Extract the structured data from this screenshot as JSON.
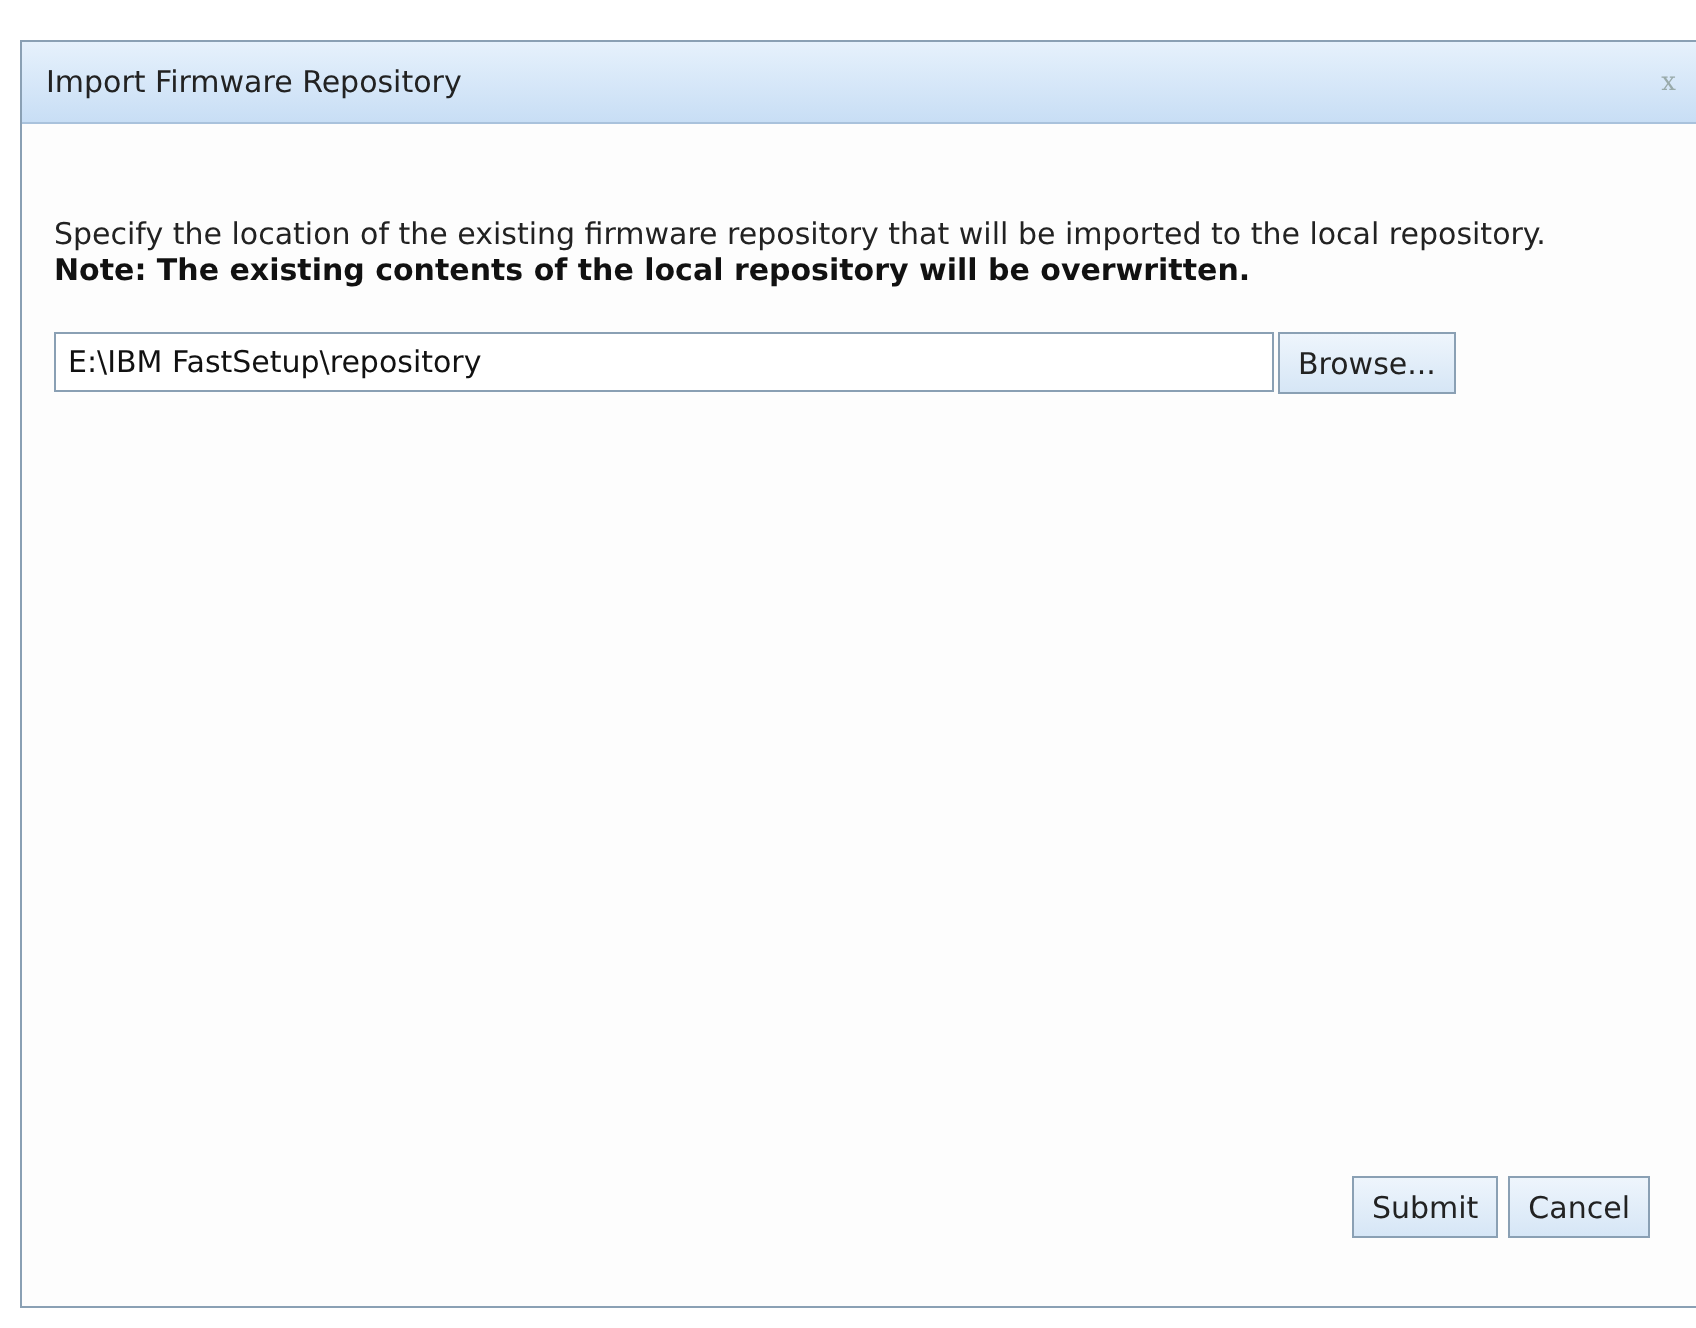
{
  "dialog": {
    "title": "Import Firmware Repository",
    "close": "x",
    "description": "Specify the location of the existing firmware repository that will be imported to the local repository.",
    "note": "Note: The existing contents of the local repository will be overwritten.",
    "path_field": {
      "value": "E:\\IBM FastSetup\\repository"
    },
    "browse_button": "Browse...",
    "buttons": [
      "Submit",
      "Cancel"
    ]
  }
}
